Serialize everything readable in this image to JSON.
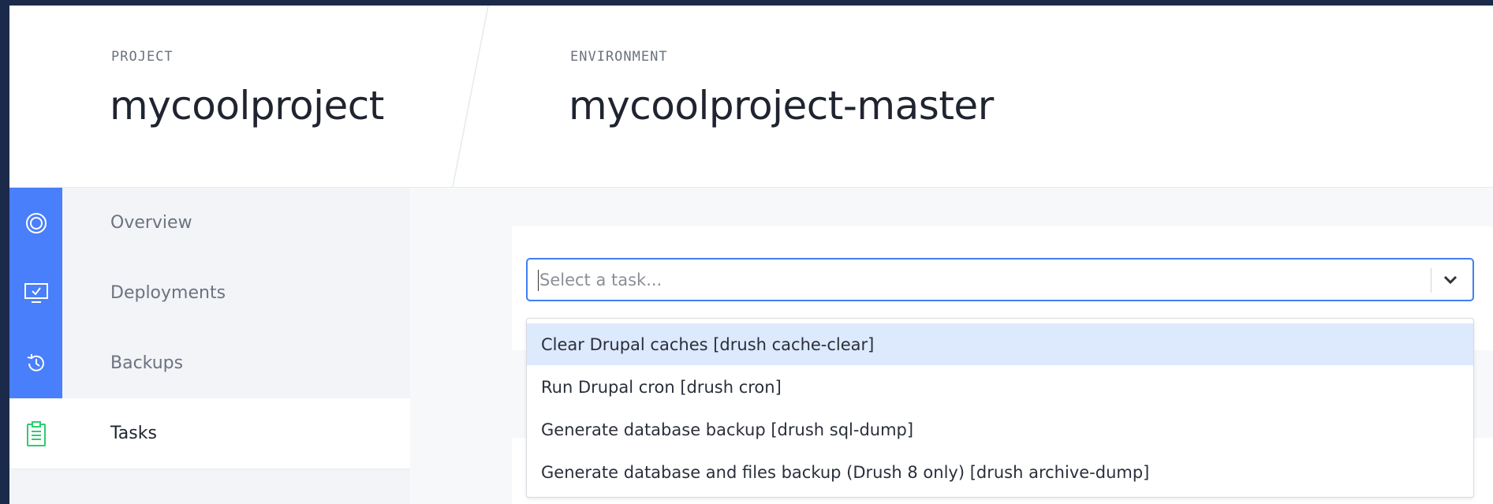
{
  "header": {
    "project_label": "PROJECT",
    "project_name": "mycoolproject",
    "environment_label": "ENVIRONMENT",
    "environment_name": "mycoolproject-master"
  },
  "sidebar": {
    "items": [
      {
        "label": "Overview",
        "icon": "overview-icon",
        "active": false
      },
      {
        "label": "Deployments",
        "icon": "monitor-check-icon",
        "active": false
      },
      {
        "label": "Backups",
        "icon": "history-icon",
        "active": false
      },
      {
        "label": "Tasks",
        "icon": "clipboard-icon",
        "active": true
      }
    ]
  },
  "task_select": {
    "placeholder": "Select a task...",
    "options": [
      "Clear Drupal caches [drush cache-clear]",
      "Run Drupal cron [drush cron]",
      "Generate database backup [drush sql-dump]",
      "Generate database and files backup (Drush 8 only) [drush archive-dump]"
    ],
    "highlighted_index": 0
  },
  "colors": {
    "accent": "#497ffa",
    "select_border": "#3f7ff5",
    "highlight": "#dde9fd",
    "active_icon": "#2ecc71",
    "outer_frame": "#1b2a4a"
  }
}
